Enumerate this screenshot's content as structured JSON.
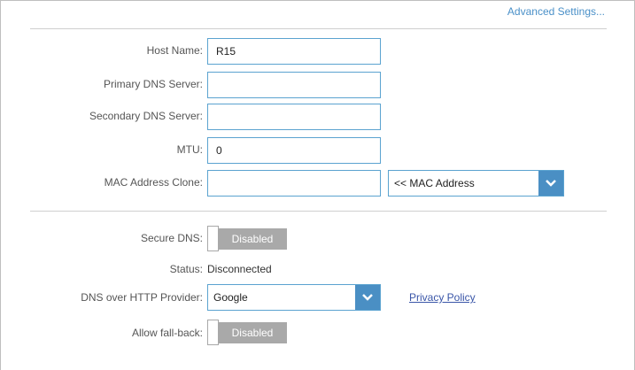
{
  "header": {
    "advanced_link": "Advanced Settings..."
  },
  "form": {
    "host_name": {
      "label": "Host Name:",
      "value": "R15"
    },
    "primary_dns": {
      "label": "Primary DNS Server:",
      "value": ""
    },
    "secondary_dns": {
      "label": "Secondary DNS Server:",
      "value": ""
    },
    "mtu": {
      "label": "MTU:",
      "value": "0"
    },
    "mac_clone": {
      "label": "MAC Address Clone:",
      "value": "",
      "select_value": "<< MAC Address"
    }
  },
  "dns": {
    "secure_dns": {
      "label": "Secure DNS:",
      "state": "Disabled"
    },
    "status": {
      "label": "Status:",
      "value": "Disconnected"
    },
    "provider": {
      "label": "DNS over HTTP Provider:",
      "value": "Google",
      "link": "Privacy Policy"
    },
    "fallback": {
      "label": "Allow fall-back:",
      "state": "Disabled"
    }
  },
  "colors": {
    "accent": "#4a8fc4",
    "field_border": "#5ba3d0",
    "toggle_off": "#a9a9a9",
    "link": "#3a56a8"
  }
}
